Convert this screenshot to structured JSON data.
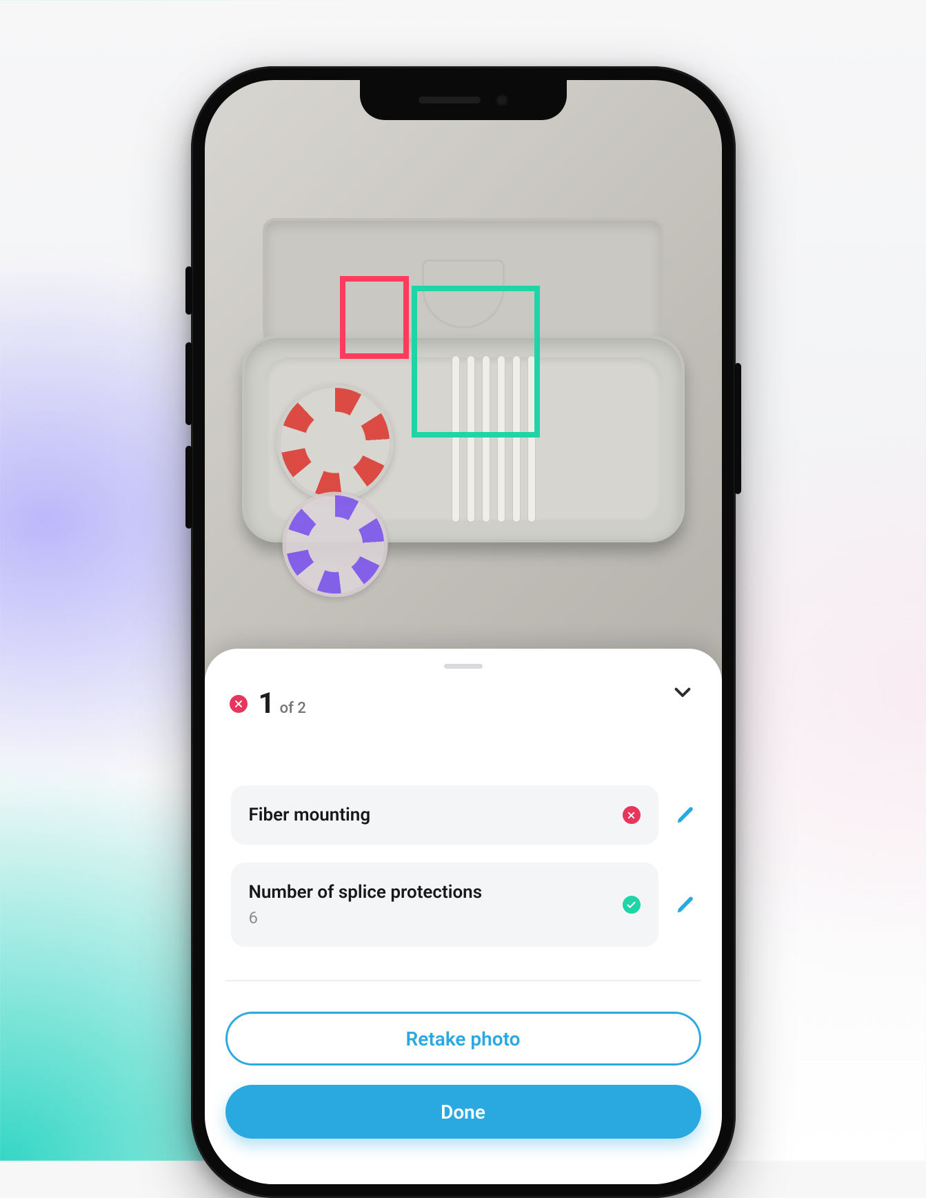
{
  "progress": {
    "status": "error",
    "current": "1",
    "of_label": "of 2"
  },
  "detections": {
    "red_box_label": "fiber-mounting-region",
    "green_box_label": "splice-protection-region"
  },
  "items": [
    {
      "title": "Fiber mounting",
      "value": "",
      "status": "error"
    },
    {
      "title": "Number of splice protections",
      "value": "6",
      "status": "ok"
    }
  ],
  "actions": {
    "retake_label": "Retake photo",
    "done_label": "Done"
  },
  "colors": {
    "accent": "#2aa9e0",
    "error": "#e8355c",
    "ok": "#1fd4a7"
  }
}
